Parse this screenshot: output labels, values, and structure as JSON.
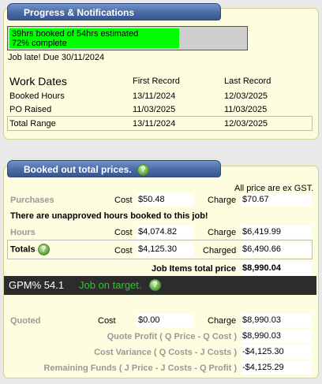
{
  "progress_panel": {
    "title": "Progress & Notifications",
    "bar_line1": "39hrs booked of 54hrs estimated",
    "bar_line2": "72% complete",
    "progress_fraction": 0.72,
    "late_text": "Job late! Due 30/11/2024",
    "work_dates": {
      "heading": "Work Dates",
      "col_first": "First Record",
      "col_last": "Last Record",
      "rows": [
        {
          "label": "Booked Hours",
          "first": "13/11/2024",
          "last": "12/03/2025"
        },
        {
          "label": "PO Raised",
          "first": "11/03/2025",
          "last": "11/03/2025"
        },
        {
          "label": "Total Range",
          "first": "13/11/2024",
          "last": "12/03/2025"
        }
      ]
    }
  },
  "prices_panel": {
    "title": "Booked out total prices.",
    "gst_note": "All price are ex GST.",
    "purchases": {
      "label": "Purchases",
      "cost_label": "Cost",
      "cost": "$50.48",
      "charge_label": "Charge",
      "charge": "$70.67"
    },
    "unapproved_warning": "There are unapproved hours booked to this job!",
    "hours": {
      "label": "Hours",
      "cost_label": "Cost",
      "cost": "$4,074.82",
      "charge_label": "Charge",
      "charge": "$6,419.99"
    },
    "totals": {
      "label": "Totals",
      "cost_label": "Cost",
      "cost": "$4,125.30",
      "charge_label": "Charged",
      "charge": "$6,490.66"
    },
    "job_items_label": "Job Items total price",
    "job_items_value": "$8,990.04",
    "gpm_label": "GPM% 54.1",
    "gpm_status": "Job on target.",
    "quoted": {
      "label": "Quoted",
      "cost_label": "Cost",
      "cost": "$0.00",
      "charge_label": "Charge",
      "charge": "$8,990.03"
    },
    "quote_profit_label": "Quote Profit ( Q Price - Q Cost )",
    "quote_profit_value": "$8,990.03",
    "cost_variance_label": "Cost Variance ( Q Costs - J Costs )",
    "cost_variance_value": "-$4,125.30",
    "remaining_funds_label": "Remaining Funds ( J Price - J Costs - Q Profit )",
    "remaining_funds_value": "-$4,125.29"
  },
  "colors": {
    "tab_blue": "#4a6aa6",
    "progress_green": "#00ff00",
    "gpm_green": "#22cc22",
    "panel_bg": "#fffde0"
  }
}
